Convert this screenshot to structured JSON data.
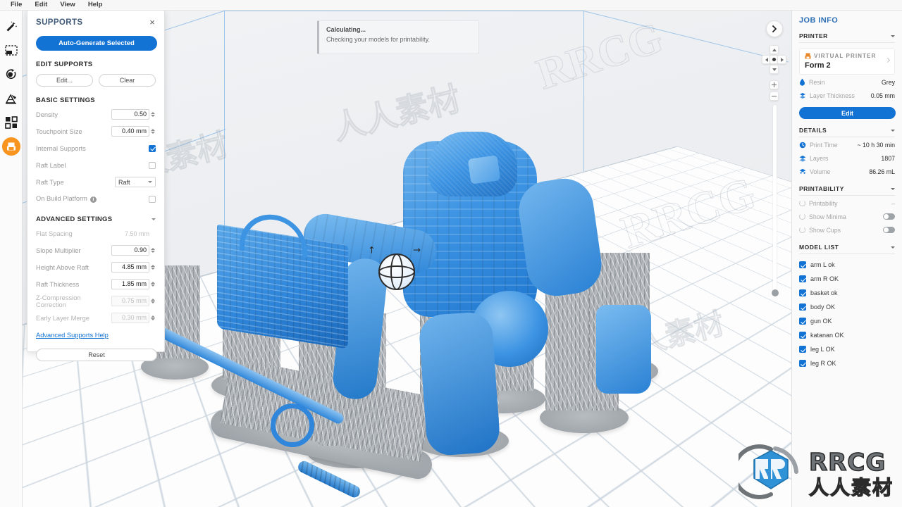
{
  "menubar": {
    "items": [
      {
        "label": "File"
      },
      {
        "label": "Edit"
      },
      {
        "label": "View"
      },
      {
        "label": "Help"
      }
    ]
  },
  "toolbar": {
    "items": [
      {
        "name": "magic-wand-icon",
        "label": "Magic Select"
      },
      {
        "name": "marquee-select-icon",
        "label": "Select"
      },
      {
        "name": "orientation-icon",
        "label": "Orient"
      },
      {
        "name": "supports-icon",
        "label": "Supports"
      },
      {
        "name": "layout-grid-icon",
        "label": "Layout"
      },
      {
        "name": "print-job-icon",
        "label": "Print"
      }
    ]
  },
  "supports_panel": {
    "title": "SUPPORTS",
    "close_label": "×",
    "auto_generate_label": "Auto-Generate Selected",
    "edit_supports_heading": "EDIT SUPPORTS",
    "edit_label": "Edit...",
    "clear_label": "Clear",
    "basic_settings_heading": "BASIC SETTINGS",
    "basic_fields": [
      {
        "label": "Density",
        "value": "0.50",
        "type": "number",
        "disabled": false
      },
      {
        "label": "Touchpoint Size",
        "value": "0.40 mm",
        "type": "number",
        "disabled": false
      },
      {
        "label": "Internal Supports",
        "value": "",
        "type": "checkbox",
        "checked": true
      },
      {
        "label": "Raft Label",
        "value": "",
        "type": "checkbox",
        "checked": false
      },
      {
        "label": "Raft Type",
        "value": "Raft",
        "type": "select"
      },
      {
        "label": "On Build Platform",
        "value": "",
        "type": "checkbox-info",
        "checked": false
      }
    ],
    "advanced_settings_heading": "ADVANCED SETTINGS",
    "advanced_fields": [
      {
        "label": "Flat Spacing",
        "value": "7.50 mm",
        "type": "plain",
        "disabled": true
      },
      {
        "label": "Slope Multiplier",
        "value": "0.90",
        "type": "number",
        "disabled": false
      },
      {
        "label": "Height Above Raft",
        "value": "4.85 mm",
        "type": "number",
        "disabled": false
      },
      {
        "label": "Raft Thickness",
        "value": "1.85 mm",
        "type": "number",
        "disabled": false
      },
      {
        "label": "Z-Compression Correction",
        "value": "0.75 mm",
        "type": "number",
        "disabled": true
      },
      {
        "label": "Early Layer Merge",
        "value": "0.30 mm",
        "type": "number",
        "disabled": true
      }
    ],
    "help_link_label": "Advanced Supports Help",
    "reset_label": "Reset"
  },
  "toast": {
    "title": "Calculating...",
    "message": "Checking your models for printability."
  },
  "job_info": {
    "title": "JOB INFO",
    "printer_heading": "PRINTER",
    "printer_tag": "VIRTUAL PRINTER",
    "printer_name": "Form 2",
    "resin_label": "Resin",
    "resin_value": "Grey",
    "layer_thickness_label": "Layer Thickness",
    "layer_thickness_value": "0.05 mm",
    "edit_label": "Edit",
    "details_heading": "DETAILS",
    "details": [
      {
        "label": "Print Time",
        "value": "~ 10 h 30 min",
        "icon": "clock-icon"
      },
      {
        "label": "Layers",
        "value": "1807",
        "icon": "layers-icon"
      },
      {
        "label": "Volume",
        "value": "86.26 mL",
        "icon": "volume-icon"
      }
    ],
    "printability_heading": "PRINTABILITY",
    "printability_rows": [
      {
        "label": "Printability",
        "value": "–",
        "type": "value"
      },
      {
        "label": "Show Minima",
        "value": "",
        "type": "toggle",
        "on": false
      },
      {
        "label": "Show Cups",
        "value": "",
        "type": "toggle",
        "on": false
      }
    ],
    "model_list_heading": "MODEL LIST",
    "models": [
      {
        "label": "arm L ok",
        "checked": true
      },
      {
        "label": "arm R OK",
        "checked": true
      },
      {
        "label": "basket ok",
        "checked": true
      },
      {
        "label": "body OK",
        "checked": true
      },
      {
        "label": "gun OK",
        "checked": true
      },
      {
        "label": "katanan OK",
        "checked": true
      },
      {
        "label": "leg L OK",
        "checked": true
      },
      {
        "label": "leg R OK",
        "checked": true
      }
    ]
  },
  "viewport": {
    "nav_expand_label": "❯",
    "watermarks": [
      "RRCG",
      "人人素材"
    ]
  },
  "branding": {
    "logo_text": "RRCG",
    "logo_subtext": "人人素材"
  },
  "colors": {
    "accent_blue": "#1273d4",
    "title_blue": "#2f6fb5",
    "active_orange": "#f79520",
    "model_blue": "#3d94e3",
    "support_grey": "#b3b8bd"
  }
}
